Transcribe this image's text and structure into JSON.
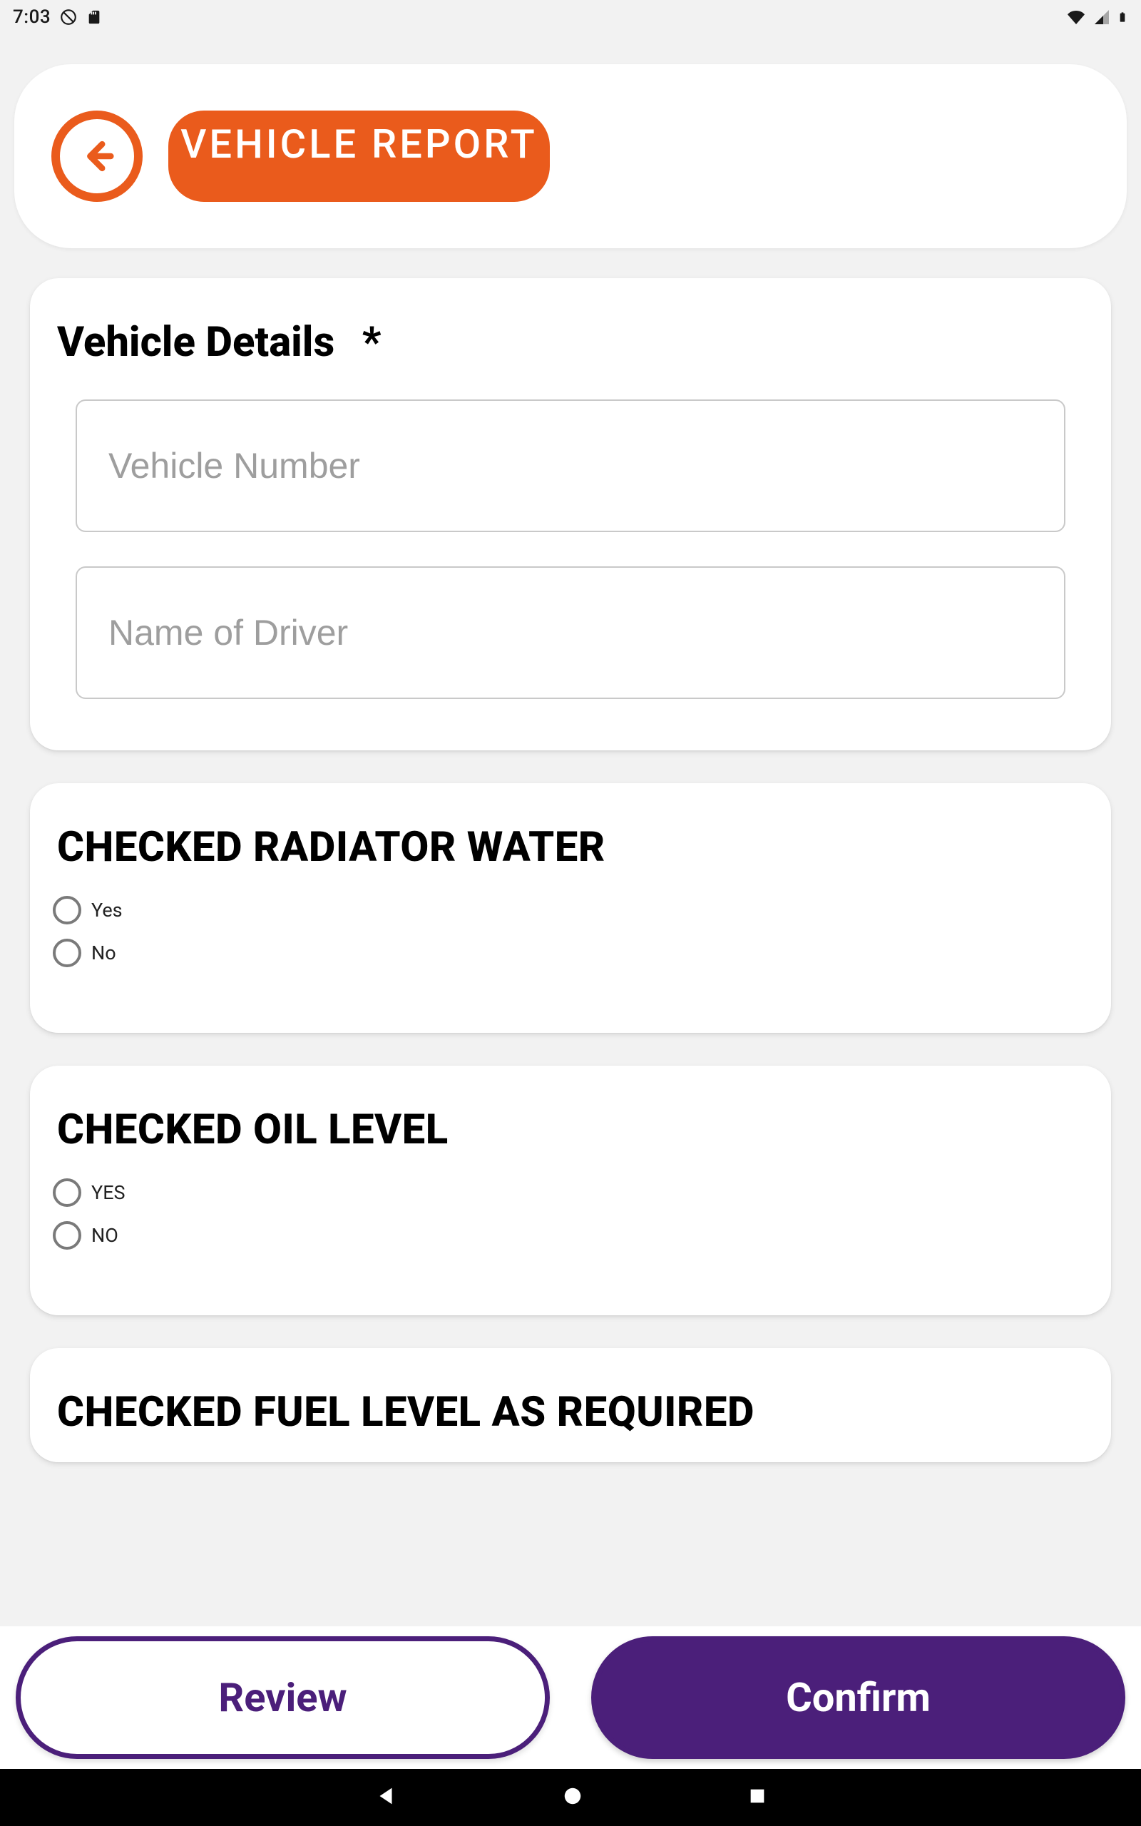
{
  "status": {
    "time": "7:03"
  },
  "header": {
    "title": "VEHICLE REPORT"
  },
  "sections": {
    "vehicleDetails": {
      "title": "Vehicle Details",
      "required_mark": "*",
      "fields": {
        "vehicleNumberPlaceholder": "Vehicle Number",
        "driverNamePlaceholder": "Name of Driver"
      }
    },
    "radiator": {
      "title": "CHECKED RADIATOR WATER",
      "options": {
        "yes": "Yes",
        "no": "No"
      }
    },
    "oil": {
      "title": "CHECKED OIL LEVEL",
      "options": {
        "yes": "YES",
        "no": "NO"
      }
    },
    "fuel": {
      "title": "CHECKED FUEL LEVEL AS REQUIRED"
    }
  },
  "actions": {
    "review": "Review",
    "confirm": "Confirm"
  }
}
